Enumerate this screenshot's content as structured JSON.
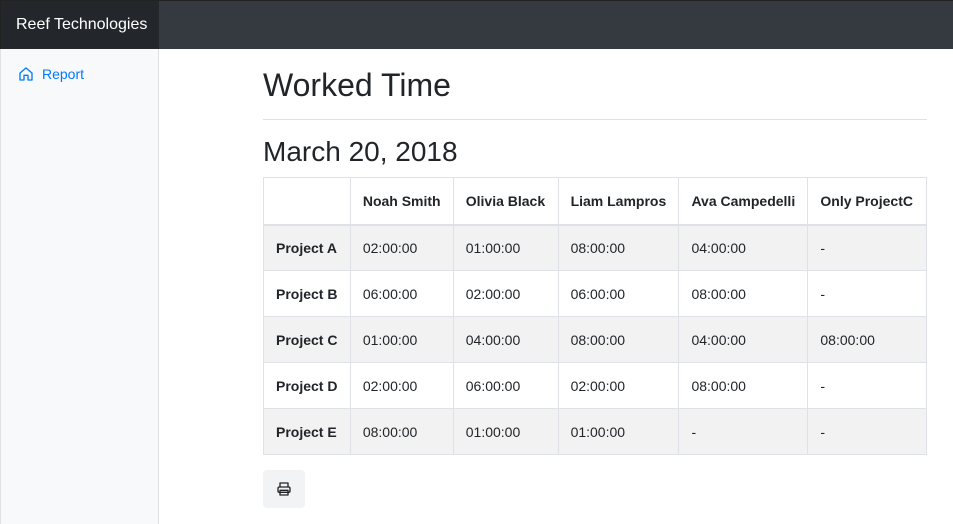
{
  "app": {
    "brand": "Reef Technologies"
  },
  "sidebar": {
    "items": [
      {
        "label": "Report",
        "icon": "home-icon"
      }
    ]
  },
  "page": {
    "title": "Worked Time",
    "date": "March 20, 2018"
  },
  "table": {
    "headers": [
      "",
      "Noah Smith",
      "Olivia Black",
      "Liam Lampros",
      "Ava Campedelli",
      "Only ProjectC"
    ],
    "rows": [
      {
        "project": "Project A",
        "cells": [
          "02:00:00",
          "01:00:00",
          "08:00:00",
          "04:00:00",
          "-"
        ]
      },
      {
        "project": "Project B",
        "cells": [
          "06:00:00",
          "02:00:00",
          "06:00:00",
          "08:00:00",
          "-"
        ]
      },
      {
        "project": "Project C",
        "cells": [
          "01:00:00",
          "04:00:00",
          "08:00:00",
          "04:00:00",
          "08:00:00"
        ]
      },
      {
        "project": "Project D",
        "cells": [
          "02:00:00",
          "06:00:00",
          "02:00:00",
          "08:00:00",
          "-"
        ]
      },
      {
        "project": "Project E",
        "cells": [
          "08:00:00",
          "01:00:00",
          "01:00:00",
          "-",
          "-"
        ]
      }
    ]
  },
  "actions": {
    "print_icon": "printer-icon"
  },
  "colors": {
    "topbar": "#343a40",
    "brand_bg": "#23272b",
    "link": "#007bff",
    "stripe": "#f2f2f2"
  }
}
